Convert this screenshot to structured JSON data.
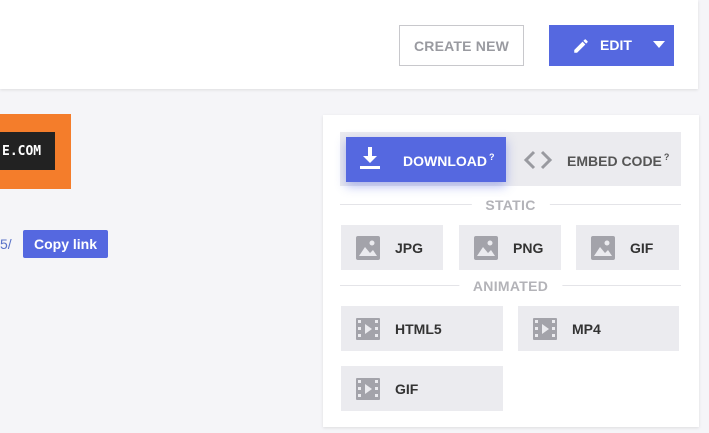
{
  "header": {
    "create_new_label": "CREATE NEW",
    "edit_label": "EDIT"
  },
  "preview": {
    "thumbnail_text": "E.COM",
    "url_fragment": "5/",
    "copy_link_label": "Copy link"
  },
  "panel": {
    "tabs": {
      "download": {
        "label": "DOWNLOAD",
        "help": "?"
      },
      "embed": {
        "label": "EMBED CODE",
        "help": "?"
      }
    },
    "static_heading": "STATIC",
    "static_formats": [
      {
        "label": "JPG",
        "icon": "image-icon"
      },
      {
        "label": "PNG",
        "icon": "image-icon"
      },
      {
        "label": "GIF",
        "icon": "image-icon"
      }
    ],
    "animated_heading": "ANIMATED",
    "animated_formats": [
      {
        "label": "HTML5",
        "icon": "video-icon"
      },
      {
        "label": "MP4",
        "icon": "video-icon"
      },
      {
        "label": "GIF",
        "icon": "video-icon"
      }
    ]
  },
  "colors": {
    "accent": "#5568e0",
    "thumbnail_orange": "#f47d2b",
    "button_gray": "#ebebef"
  }
}
